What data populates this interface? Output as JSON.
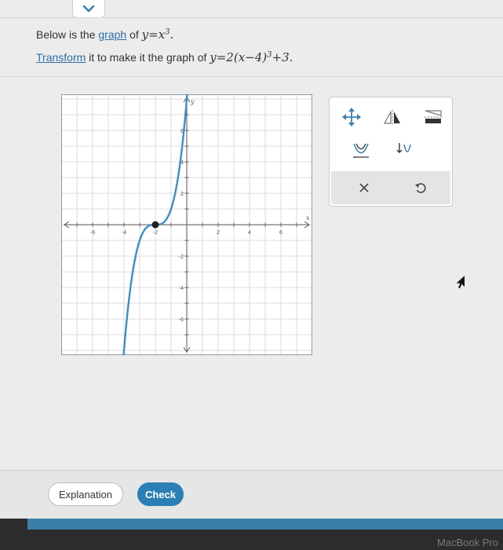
{
  "prompt": {
    "line1_prefix": "Below is the ",
    "line1_link": "graph",
    "line1_mid": " of ",
    "line1_math": "y=x",
    "line1_exp": "3",
    "line1_end": ".",
    "line2_link": "Transform",
    "line2_mid": " it to make it the graph of ",
    "line2_math_a": "y=2(x−4)",
    "line2_exp": "3",
    "line2_math_b": "+3."
  },
  "graph": {
    "x_axis_label": "x",
    "y_axis_label": "y",
    "x_tick_labels": [
      "-6",
      "-4",
      "-2",
      "2",
      "4",
      "6"
    ],
    "y_tick_labels": [
      "6",
      "4",
      "2",
      "-2",
      "-4",
      "-6"
    ]
  },
  "toolbox": {
    "tools": [
      {
        "name": "move-icon"
      },
      {
        "name": "reflect-vertical-icon"
      },
      {
        "name": "reflect-horizontal-icon"
      },
      {
        "name": "stretch-vertical-icon"
      },
      {
        "name": "shrink-vertical-icon"
      }
    ],
    "reset_icon": "clear-icon",
    "undo_icon": "undo-icon"
  },
  "buttons": {
    "explanation": "Explanation",
    "check": "Check"
  },
  "device": {
    "brand": "MacBook Pro"
  },
  "colors": {
    "curve": "#3a8fc9",
    "check_button": "#2b7fb5",
    "link": "#2c6ea8"
  }
}
